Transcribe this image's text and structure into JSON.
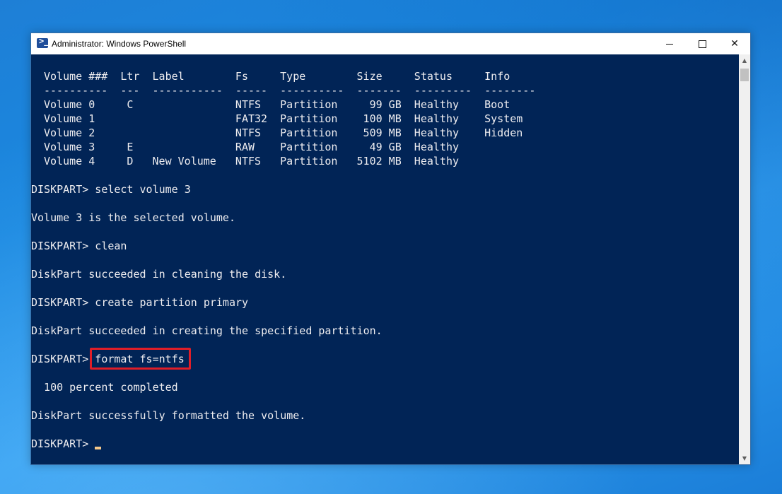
{
  "window": {
    "title": "Administrator: Windows PowerShell",
    "icon": "powershell-icon",
    "icon_glyph": ">_",
    "controls": {
      "minimize_icon": "minimize-icon",
      "maximize_icon": "maximize-icon",
      "close_icon": "close-icon",
      "close_glyph": "✕"
    }
  },
  "console": {
    "header": "Volume ###  Ltr  Label        Fs     Type        Size     Status     Info",
    "separator": "----------  ---  -----------  -----  ----------  -------  ---------  --------",
    "volumes": [
      "Volume 0     C                NTFS   Partition     99 GB  Healthy    Boot",
      "Volume 1                      FAT32  Partition    100 MB  Healthy    System",
      "Volume 2                      NTFS   Partition    509 MB  Healthy    Hidden",
      "Volume 3     E                RAW    Partition     49 GB  Healthy",
      "Volume 4     D   New Volume   NTFS   Partition   5102 MB  Healthy"
    ],
    "transcript": [
      "DISKPART> select volume 3",
      "Volume 3 is the selected volume.",
      "DISKPART> clean",
      "DiskPart succeeded in cleaning the disk.",
      "DISKPART> create partition primary",
      "DiskPart succeeded in creating the specified partition.",
      "DISKPART> format fs=ntfs",
      "  100 percent completed",
      "DiskPart successfully formatted the volume.",
      "DISKPART> "
    ],
    "highlighted_command": "format fs=ntfs",
    "highlight_color": "#e01e28",
    "background_color": "#012456",
    "text_color": "#eeedf0"
  }
}
